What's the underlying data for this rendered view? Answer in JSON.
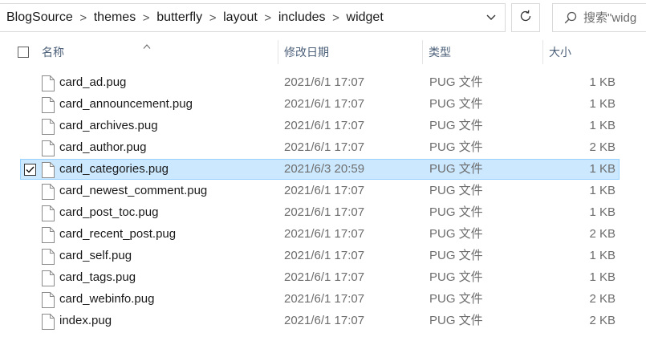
{
  "address_bar": {
    "breadcrumbs": [
      "BlogSource",
      "themes",
      "butterfly",
      "layout",
      "includes",
      "widget"
    ],
    "separator": ">"
  },
  "search": {
    "placeholder": "搜索\"widg"
  },
  "columns": {
    "name": "名称",
    "date": "修改日期",
    "type": "类型",
    "size": "大小"
  },
  "files": [
    {
      "name": "card_ad.pug",
      "date": "2021/6/1 17:07",
      "type": "PUG 文件",
      "size": "1 KB",
      "selected": false
    },
    {
      "name": "card_announcement.pug",
      "date": "2021/6/1 17:07",
      "type": "PUG 文件",
      "size": "1 KB",
      "selected": false
    },
    {
      "name": "card_archives.pug",
      "date": "2021/6/1 17:07",
      "type": "PUG 文件",
      "size": "1 KB",
      "selected": false
    },
    {
      "name": "card_author.pug",
      "date": "2021/6/1 17:07",
      "type": "PUG 文件",
      "size": "2 KB",
      "selected": false
    },
    {
      "name": "card_categories.pug",
      "date": "2021/6/3 20:59",
      "type": "PUG 文件",
      "size": "1 KB",
      "selected": true
    },
    {
      "name": "card_newest_comment.pug",
      "date": "2021/6/1 17:07",
      "type": "PUG 文件",
      "size": "1 KB",
      "selected": false
    },
    {
      "name": "card_post_toc.pug",
      "date": "2021/6/1 17:07",
      "type": "PUG 文件",
      "size": "1 KB",
      "selected": false
    },
    {
      "name": "card_recent_post.pug",
      "date": "2021/6/1 17:07",
      "type": "PUG 文件",
      "size": "2 KB",
      "selected": false
    },
    {
      "name": "card_self.pug",
      "date": "2021/6/1 17:07",
      "type": "PUG 文件",
      "size": "1 KB",
      "selected": false
    },
    {
      "name": "card_tags.pug",
      "date": "2021/6/1 17:07",
      "type": "PUG 文件",
      "size": "1 KB",
      "selected": false
    },
    {
      "name": "card_webinfo.pug",
      "date": "2021/6/1 17:07",
      "type": "PUG 文件",
      "size": "2 KB",
      "selected": false
    },
    {
      "name": "index.pug",
      "date": "2021/6/1 17:07",
      "type": "PUG 文件",
      "size": "2 KB",
      "selected": false
    }
  ],
  "icons": {
    "file": "file-icon",
    "refresh": "refresh-icon",
    "search": "search-icon",
    "dropdown": "chevron-down-icon",
    "sort": "sort-ascending-icon"
  },
  "colors": {
    "selection_bg": "#cce8ff",
    "selection_border": "#99d1ff",
    "header_text": "#4c607a"
  }
}
